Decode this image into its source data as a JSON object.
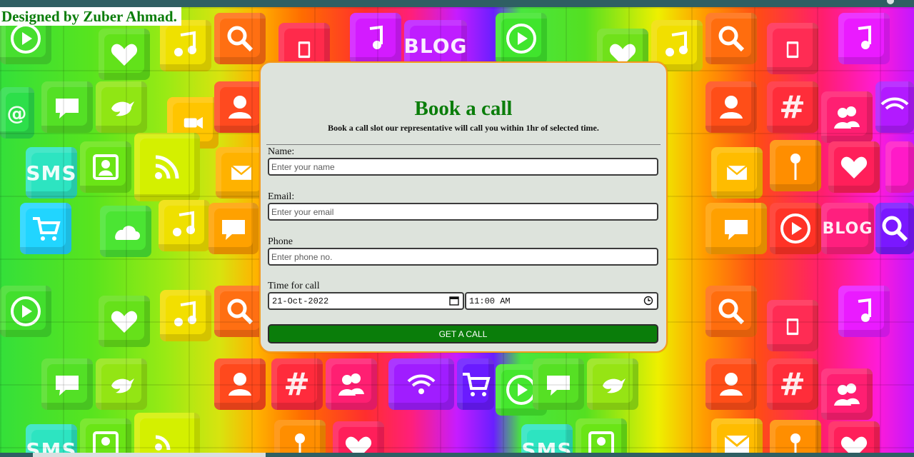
{
  "credit": "Designed by Zuber Ahmad.",
  "form": {
    "title": "Book a call",
    "subtitle": "Book a call slot our representative will call you within 1hr of selected time.",
    "name_label": "Name:",
    "name_placeholder": "Enter your name",
    "email_label": "Email:",
    "email_placeholder": "Enter your email",
    "phone_label": "Phone",
    "phone_placeholder": "Enter phone no.",
    "time_label": "Time for call",
    "date_value": "21-Oct-2022",
    "time_value": "11:00 AM",
    "submit_label": "GET A CALL"
  },
  "background": {
    "tile_texts": [
      "BLOG",
      "SMS",
      "#",
      "@"
    ],
    "icons": [
      "music-note-icon",
      "play-icon",
      "search-icon",
      "heart-icon",
      "chat-bubble-icon",
      "bird-icon",
      "user-icon",
      "wifi-icon",
      "rss-icon",
      "envelope-icon",
      "cart-icon",
      "cloud-icon",
      "phone-icon",
      "pin-icon",
      "camera-icon"
    ]
  },
  "colors": {
    "primary_green": "#0a7d0a",
    "card_background": "#dde3dc",
    "card_border": "#f59a1d"
  }
}
